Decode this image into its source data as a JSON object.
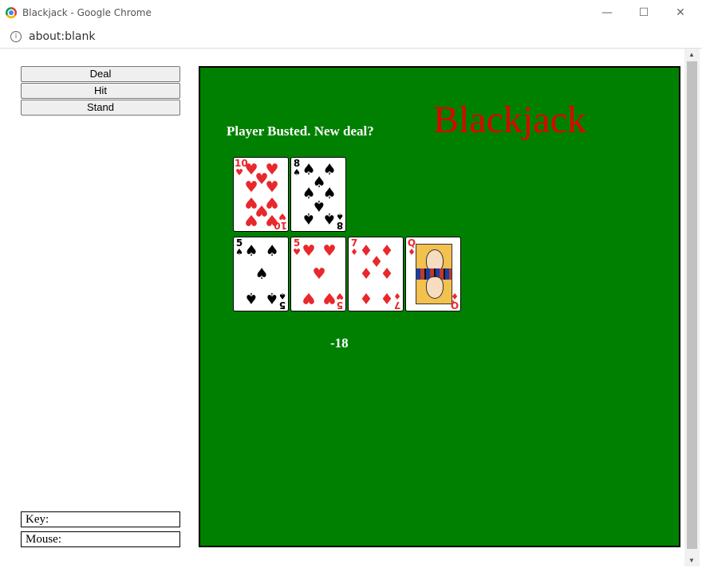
{
  "window": {
    "title": "Blackjack - Google Chrome",
    "minimize_icon": "minimize-icon",
    "maximize_icon": "maximize-icon",
    "close_icon": "close-icon"
  },
  "address_bar": {
    "url": "about:blank",
    "icon": "info-icon"
  },
  "controls": {
    "deal_label": "Deal",
    "hit_label": "Hit",
    "stand_label": "Stand",
    "key_label": "Key:",
    "mouse_label": "Mouse:"
  },
  "game": {
    "title": "Blackjack",
    "status": "Player Busted. New deal?",
    "score": "-18",
    "table_color": "#008000",
    "title_color": "#e00000",
    "dealer_hand": [
      {
        "rank": "10",
        "suit": "♥",
        "color": "red"
      },
      {
        "rank": "8",
        "suit": "♠",
        "color": "black"
      }
    ],
    "player_hand": [
      {
        "rank": "5",
        "suit": "♠",
        "color": "black"
      },
      {
        "rank": "5",
        "suit": "♥",
        "color": "red"
      },
      {
        "rank": "7",
        "suit": "♦",
        "color": "red"
      },
      {
        "rank": "Q",
        "suit": "♦",
        "color": "red"
      }
    ]
  }
}
